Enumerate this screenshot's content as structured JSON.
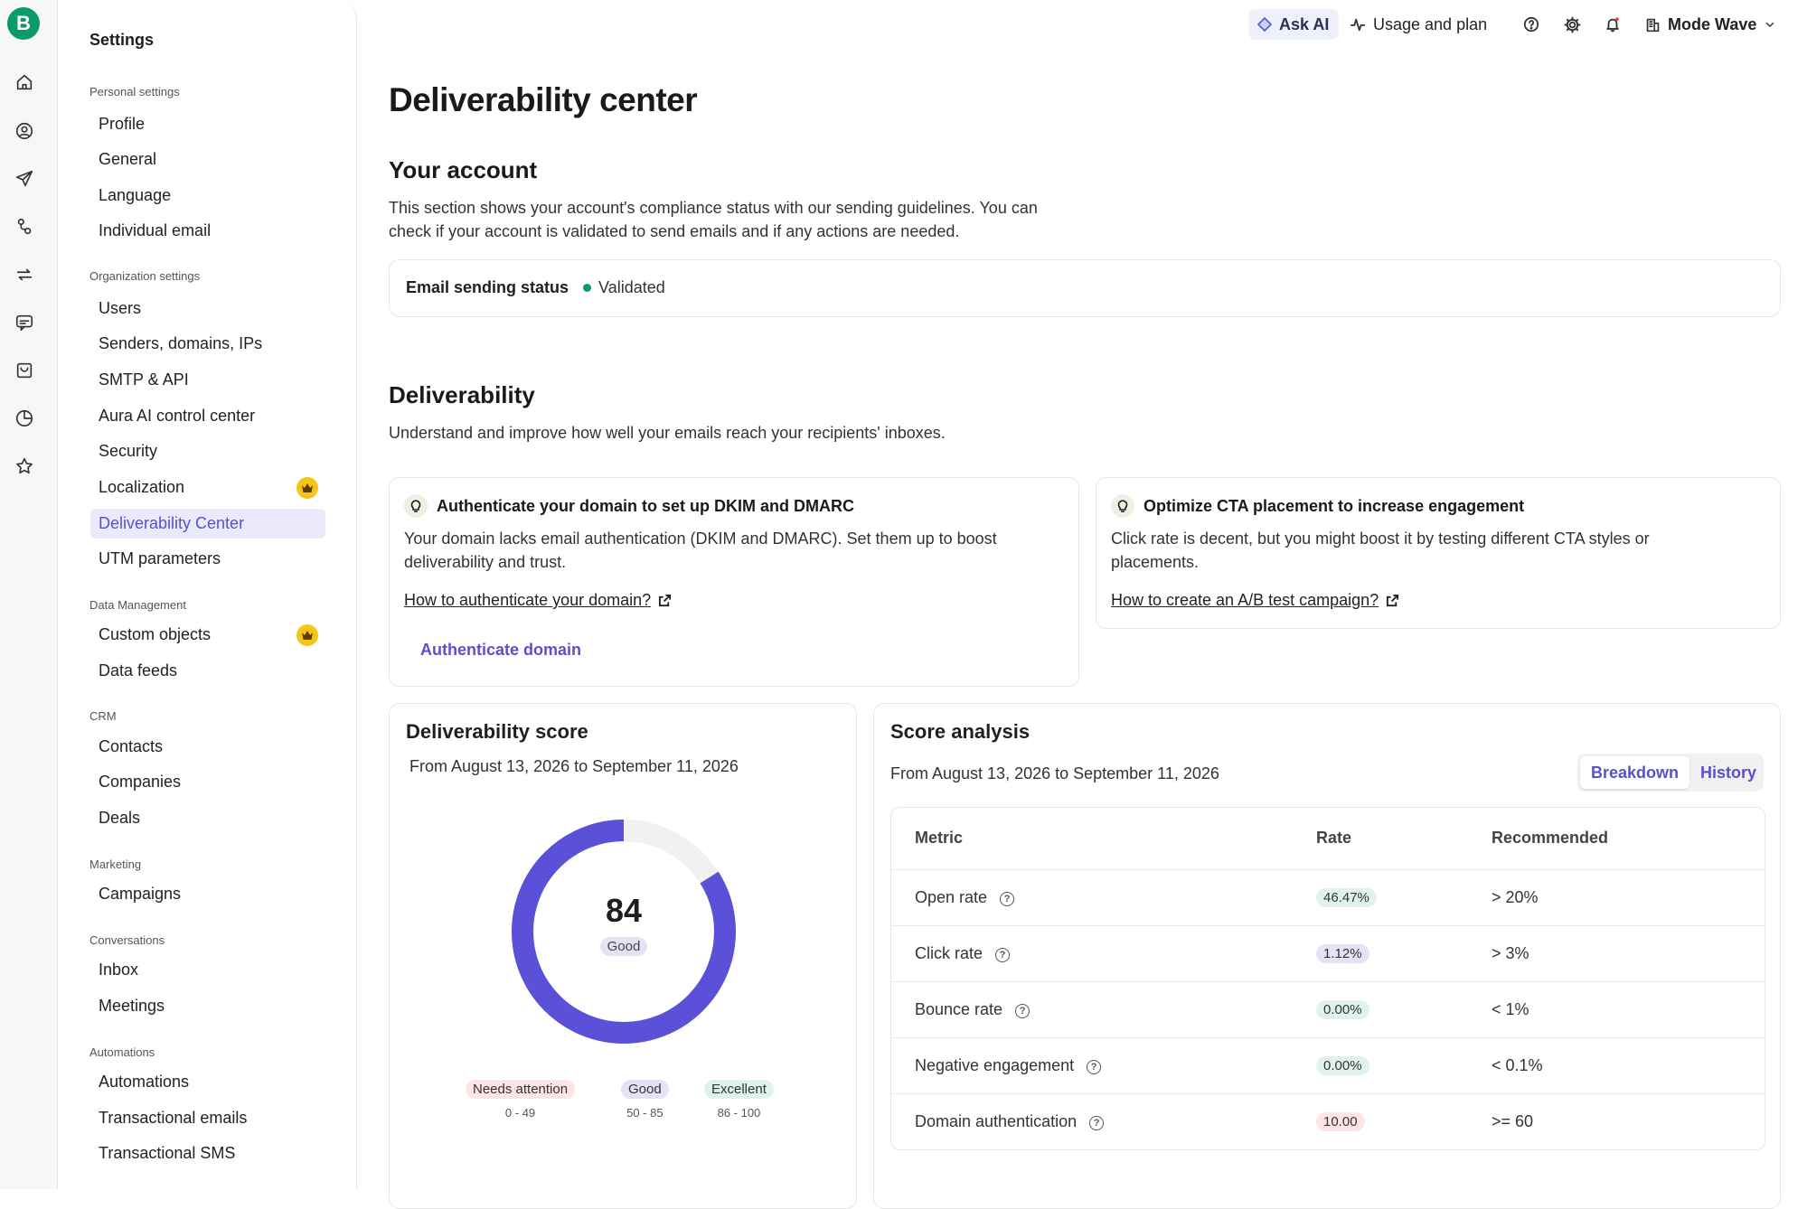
{
  "brand": {
    "logo_letter": "B",
    "accent": "#5a4fcf",
    "success": "#0b996e"
  },
  "rail": {
    "items": [
      "home-icon",
      "contacts-icon",
      "send-icon",
      "automation-icon",
      "sync-icon",
      "chat-icon",
      "shop-icon",
      "reports-icon",
      "star-icon"
    ]
  },
  "sidebar": {
    "title": "Settings",
    "sections": [
      {
        "label": "Personal settings",
        "items": [
          "Profile",
          "General",
          "Language",
          "Individual email"
        ]
      },
      {
        "label": "Organization settings",
        "items": [
          "Users",
          "Senders, domains, IPs",
          "SMTP & API",
          "Aura AI control center",
          "Security",
          "Localization",
          "Deliverability Center",
          "UTM parameters"
        ]
      },
      {
        "label": "Data Management",
        "items": [
          "Custom objects",
          "Data feeds"
        ]
      },
      {
        "label": "CRM",
        "items": [
          "Contacts",
          "Companies",
          "Deals"
        ]
      },
      {
        "label": "Marketing",
        "items": [
          "Campaigns"
        ]
      },
      {
        "label": "Conversations",
        "items": [
          "Inbox",
          "Meetings"
        ]
      },
      {
        "label": "Automations",
        "items": [
          "Automations",
          "Transactional emails",
          "Transactional SMS"
        ]
      }
    ],
    "active_item": "Deliverability Center"
  },
  "topbar": {
    "ask_ai": "Ask AI",
    "usage": "Usage and plan",
    "account": "Mode Wave"
  },
  "page": {
    "title": "Deliverability center",
    "account": {
      "heading": "Your account",
      "desc_line1": "This section shows your account's compliance status with our sending guidelines. You can",
      "desc_line2": "check if your account is validated to send emails and if any actions are needed.",
      "status_label": "Email sending status",
      "status_value": "Validated"
    },
    "deliverability": {
      "heading": "Deliverability",
      "desc": "Understand and improve how well your emails reach your recipients' inboxes."
    },
    "tips": [
      {
        "title": "Authenticate your domain to set up DKIM and DMARC",
        "line1": "Your domain lacks email authentication (DKIM and DMARC). Set them up to boost",
        "line2": "deliverability and trust.",
        "link": "How to authenticate your domain?",
        "action": "Authenticate domain"
      },
      {
        "title": "Optimize CTA placement to increase engagement",
        "line1": "Click rate is decent, but you might boost it by testing different CTA styles or",
        "line2": "placements.",
        "link": "How to create an A/B test campaign?"
      }
    ],
    "score": {
      "heading": "Deliverability score",
      "range": "From August 13, 2026 to September 11, 2026",
      "value": "84",
      "value_num": 84,
      "max": 100,
      "label": "Good",
      "legend": [
        {
          "label": "Needs attention",
          "range": "0 - 49"
        },
        {
          "label": "Good",
          "range": "50 - 85"
        },
        {
          "label": "Excellent",
          "range": "86 - 100"
        }
      ]
    },
    "analysis": {
      "heading": "Score analysis",
      "range": "From August 13, 2026 to September 11, 2026",
      "tabs": [
        "Breakdown",
        "History"
      ],
      "columns": [
        "Metric",
        "Rate",
        "Recommended"
      ],
      "rows": [
        {
          "metric": "Open rate",
          "rate": "46.47%",
          "rec": "> 20%"
        },
        {
          "metric": "Click rate",
          "rate": "1.12%",
          "rec": "> 3%"
        },
        {
          "metric": "Bounce rate",
          "rate": "0.00%",
          "rec": "< 1%"
        },
        {
          "metric": "Negative engagement",
          "rate": "0.00%",
          "rec": "< 0.1%"
        },
        {
          "metric": "Domain authentication",
          "rate": "10.00",
          "rec": ">= 60"
        }
      ]
    }
  }
}
